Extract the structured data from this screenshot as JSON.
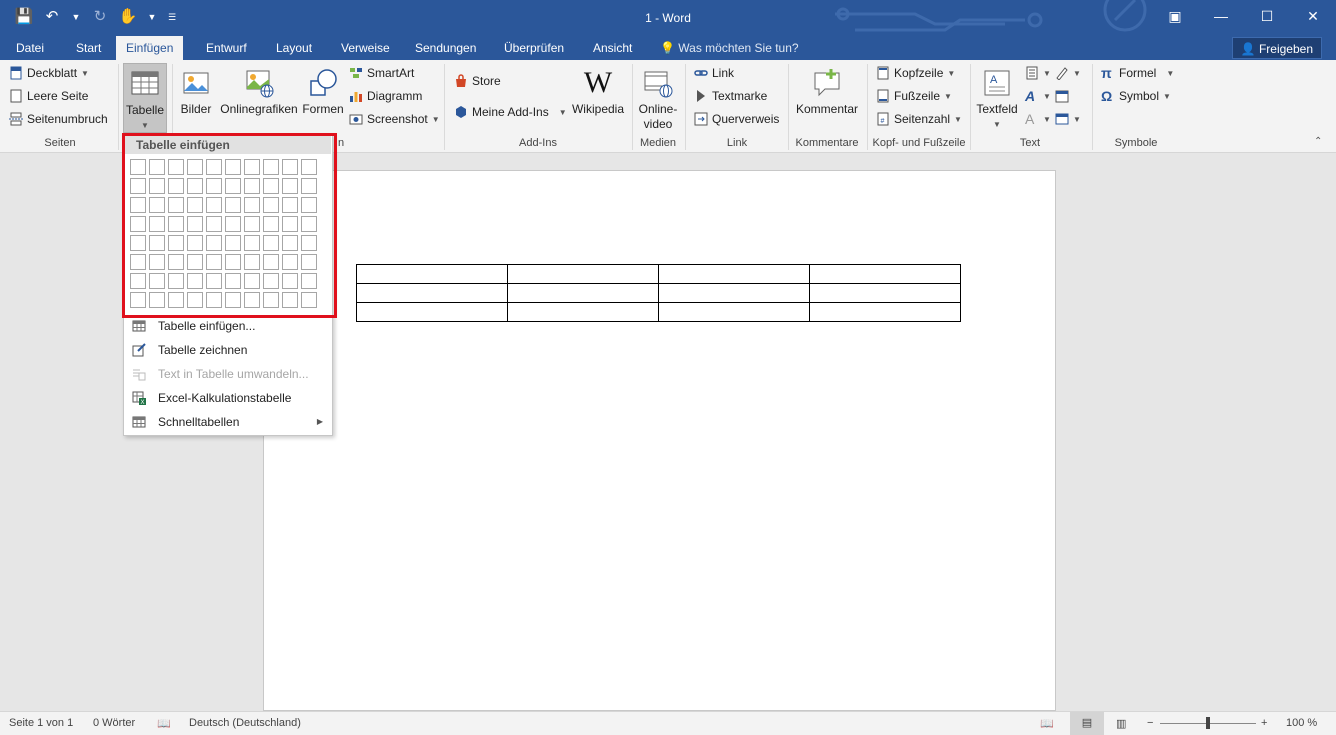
{
  "window": {
    "title": "1 - Word"
  },
  "qat": {
    "save_icon": "save-icon",
    "undo_icon": "undo-icon",
    "redo_icon": "redo-icon",
    "touch_icon": "touch-mode-icon"
  },
  "window_controls": {
    "ribbon_options": "ribbon-display-options-icon",
    "minimize": "minimize-icon",
    "maximize": "maximize-icon",
    "close": "close-icon"
  },
  "tabs": [
    {
      "label": "Datei"
    },
    {
      "label": "Start"
    },
    {
      "label": "Einfügen"
    },
    {
      "label": "Entwurf"
    },
    {
      "label": "Layout"
    },
    {
      "label": "Verweise"
    },
    {
      "label": "Sendungen"
    },
    {
      "label": "Überprüfen"
    },
    {
      "label": "Ansicht"
    }
  ],
  "tell_me": {
    "placeholder": "Was möchten Sie tun?"
  },
  "share": {
    "label": "Freigeben"
  },
  "ribbon": {
    "seiten": {
      "label": "Seiten",
      "deckblatt": "Deckblatt",
      "leere_seite": "Leere Seite",
      "seitenumbruch": "Seitenumbruch"
    },
    "tabelle": {
      "label": "Tabelle"
    },
    "illustrationen": {
      "label_tail": "n",
      "bilder": "Bilder",
      "onlinegrafiken": "Onlinegrafiken",
      "formen": "Formen",
      "smartart": "SmartArt",
      "diagramm": "Diagramm",
      "screenshot": "Screenshot"
    },
    "addins": {
      "label": "Add-Ins",
      "store": "Store",
      "meine_addins": "Meine Add-Ins",
      "wikipedia": "Wikipedia"
    },
    "medien": {
      "label": "Medien",
      "onlinevideo_1": "Online-",
      "onlinevideo_2": "video"
    },
    "link": {
      "label": "Link",
      "link": "Link",
      "textmarke": "Textmarke",
      "querverweis": "Querverweis"
    },
    "kommentare": {
      "label": "Kommentare",
      "kommentar": "Kommentar"
    },
    "kopf": {
      "label": "Kopf- und Fußzeile",
      "kopfzeile": "Kopfzeile",
      "fusszeile": "Fußzeile",
      "seitenzahl": "Seitenzahl"
    },
    "text": {
      "label": "Text",
      "textfeld": "Textfeld"
    },
    "symbole": {
      "label": "Symbole",
      "formel": "Formel",
      "symbol": "Symbol"
    }
  },
  "dropdown": {
    "header": "Tabelle einfügen",
    "grid": {
      "columns": 10,
      "rows": 8
    },
    "items": [
      {
        "label": "Tabelle einfügen...",
        "icon": "insert-table-icon",
        "disabled": false
      },
      {
        "label": "Tabelle zeichnen",
        "icon": "draw-table-icon",
        "disabled": false
      },
      {
        "label": "Text in Tabelle umwandeln...",
        "icon": "convert-text-icon",
        "disabled": true
      },
      {
        "label": "Excel-Kalkulationstabelle",
        "icon": "excel-icon",
        "disabled": false
      },
      {
        "label": "Schnelltabellen",
        "icon": "quick-tables-icon",
        "disabled": false
      }
    ]
  },
  "document": {
    "table": {
      "rows": 3,
      "columns": 4
    }
  },
  "status": {
    "page": "Seite 1 von 1",
    "words": "0 Wörter",
    "language": "Deutsch (Deutschland)",
    "zoom": "100 %"
  },
  "colors": {
    "accent": "#2b579a",
    "highlight": "#e0101c"
  }
}
